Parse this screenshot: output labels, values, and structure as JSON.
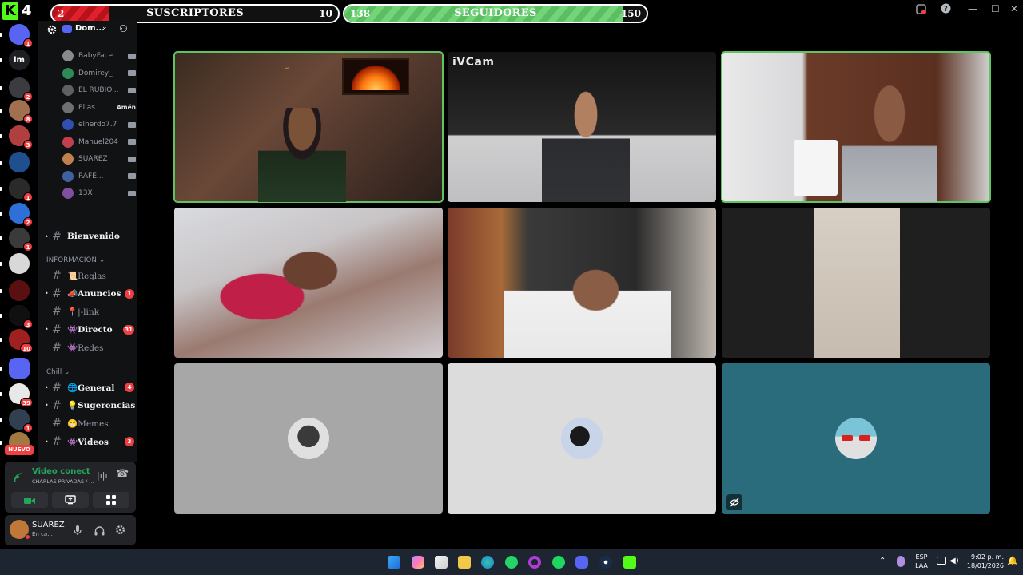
{
  "topbar": {
    "channel_number": "4",
    "subs_goal": {
      "current": "2",
      "title": "SUSCRIPTORES",
      "target": "10",
      "progress": 0.2
    },
    "fol_goal": {
      "current": "138",
      "title": "SEGUIDORES",
      "target": "150",
      "progress": 0.92
    }
  },
  "rail": {
    "servers": [
      {
        "badge": "1",
        "color": "#5865f2",
        "icon": "discord-icon"
      },
      {
        "badge": "",
        "color": "#1e1f22",
        "icon": "lm-server-icon",
        "text": "lm"
      },
      {
        "badge": "2",
        "color": "#3a3c42"
      },
      {
        "badge": "8",
        "color": "#a07050"
      },
      {
        "badge": "3",
        "color": "#b04040"
      },
      {
        "badge": "",
        "color": "#1f4f8f"
      },
      {
        "badge": "1",
        "color": "#2a2a2a"
      },
      {
        "badge": "2",
        "color": "#2f6fd8"
      },
      {
        "badge": "1",
        "color": "#3a3a3a"
      },
      {
        "badge": "",
        "color": "#d8d8d8"
      },
      {
        "badge": "",
        "color": "#5a1010"
      },
      {
        "badge": "3",
        "color": "#101010"
      },
      {
        "badge": "10",
        "color": "#a02020"
      },
      {
        "badge": "",
        "color": "#5865f2",
        "icon": "folder-icon"
      },
      {
        "badge": "39",
        "color": "#e8e8e8"
      },
      {
        "badge": "1",
        "color": "#304050"
      },
      {
        "badge": "",
        "color": "#a07a40"
      }
    ],
    "nuevo_label": "NUEVO"
  },
  "sidebar": {
    "server_name": "Dom...",
    "voice_users": [
      {
        "name": "BabyFace",
        "color": "#8a8a8a"
      },
      {
        "name": "Domirey_",
        "color": "#2e8b57"
      },
      {
        "name": "EL RUBIO...",
        "color": "#606060"
      },
      {
        "name": "Elias",
        "extra": "Amén",
        "color": "#707070"
      },
      {
        "name": "elnerdo7.7",
        "color": "#3050b0"
      },
      {
        "name": "Manuel204",
        "color": "#c04050"
      },
      {
        "name": "SUAREZ",
        "color": "#c08050"
      },
      {
        "name": "RAFE...",
        "color": "#4060a0"
      },
      {
        "name": "13X",
        "color": "#8050a0"
      }
    ],
    "channels_top": [
      {
        "label": "Bienvenido",
        "unread": true,
        "count": ""
      }
    ],
    "category_info": "INFORMACION",
    "channels_info": [
      {
        "label": "📜Reglas",
        "unread": false,
        "count": ""
      },
      {
        "label": "📣Anuncios",
        "unread": true,
        "count": "1"
      },
      {
        "label": "📍|-link",
        "unread": false,
        "count": ""
      },
      {
        "label": "👾Directo",
        "unread": true,
        "count": "31"
      },
      {
        "label": "👾Redes",
        "unread": false,
        "count": ""
      }
    ],
    "category_chill": "Chill",
    "channels_chill": [
      {
        "label": "🌐General",
        "unread": true,
        "count": "4"
      },
      {
        "label": "💡Sugerencias",
        "unread": true,
        "count": ""
      },
      {
        "label": "😁Memes",
        "unread": false,
        "count": ""
      },
      {
        "label": "👾Videos",
        "unread": true,
        "count": "3"
      }
    ],
    "voice_status": "Video conectado",
    "voice_channel": "CHARLAS PRIVADAS / ...",
    "user_name": "SUAREZ",
    "user_status": "En ca..."
  },
  "grid": {
    "tile_label": "iVCam"
  },
  "taskbar": {
    "lang_top": "ESP",
    "lang_bottom": "LAA",
    "time": "9:02 p. m.",
    "date": "18/01/2026"
  },
  "colors": {
    "kick_green": "#53fc18",
    "speaking_outline": "#5fc35f",
    "badge_red": "#f23f43",
    "teal_tile": "#2a6b7c"
  }
}
